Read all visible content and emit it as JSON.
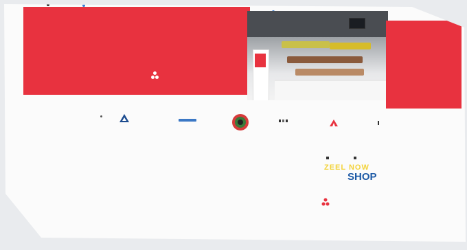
{
  "header_dots": [
    {
      "color": "#333333"
    },
    {
      "color": "#3d7fd6"
    },
    {
      "color": "#444444"
    },
    {
      "color": "#555555"
    },
    {
      "color": "#3d7fd6"
    },
    {
      "color": "#e0a93a"
    },
    {
      "color": "#3d7fd6"
    },
    {
      "color": "#3d7fd6"
    },
    {
      "color": "#3d7fd6"
    }
  ],
  "hero": {
    "accent_color": "#e8323f",
    "title": "",
    "subtitle": "",
    "lines": [
      "",
      "",
      "",
      ""
    ],
    "brand_text": ""
  },
  "partners": [
    {
      "icon": "triangle-logo-icon",
      "label": ""
    },
    {
      "icon": "text-logo-icon",
      "label": ""
    },
    {
      "icon": "circle-badge-logo-icon",
      "label": ""
    },
    {
      "icon": "dots-logo-icon",
      "label": ""
    },
    {
      "icon": "red-arrow-logo-icon",
      "label": ""
    }
  ],
  "footer": {
    "columns": [
      {
        "heading": "",
        "links": [
          "",
          "",
          "",
          ""
        ]
      },
      {
        "heading": "",
        "links": [
          "",
          "",
          ""
        ]
      },
      {
        "heading": "",
        "links": [
          "",
          "",
          ""
        ]
      }
    ],
    "shop_logo": {
      "top": "ZEEL NOW",
      "bottom": "SHOP"
    },
    "brand_text": ""
  }
}
